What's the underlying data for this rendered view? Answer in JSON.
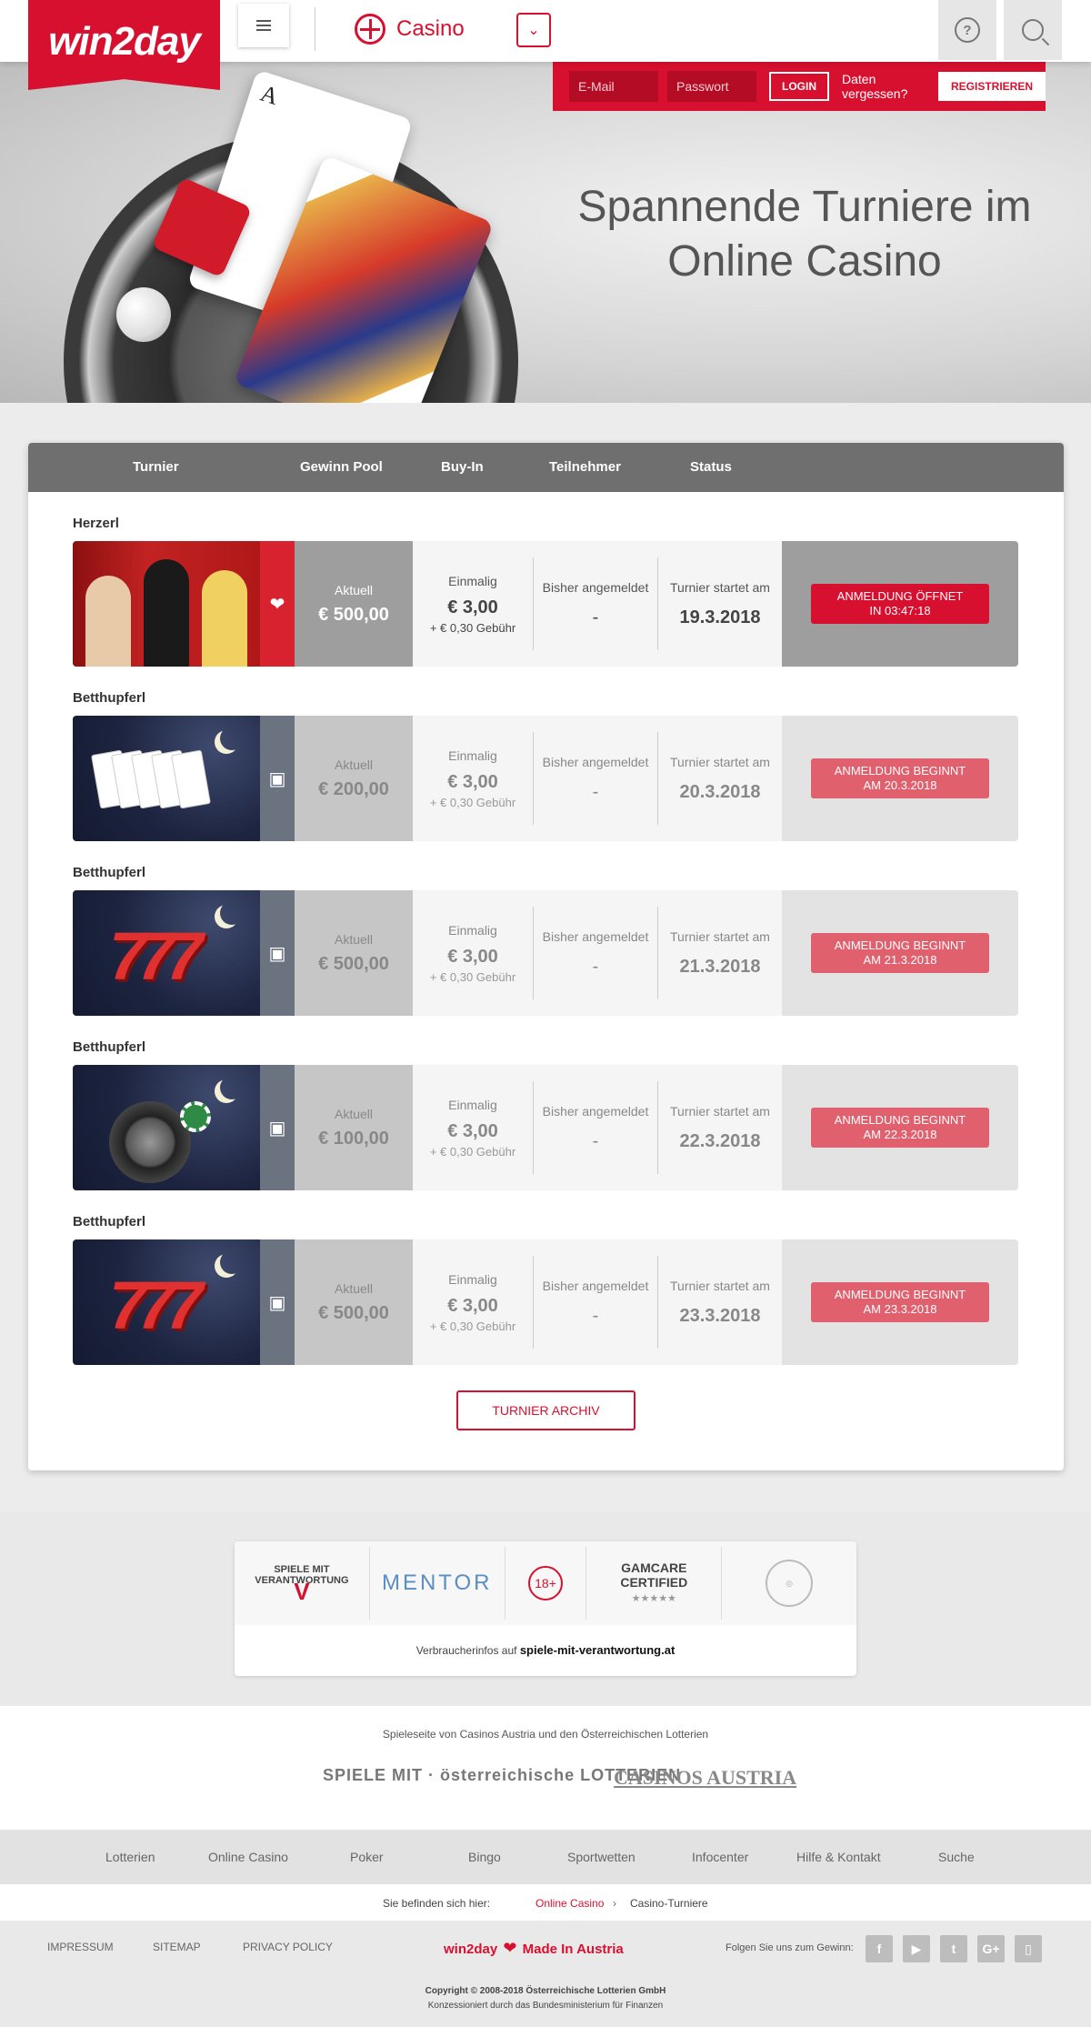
{
  "brand": {
    "logo_text": "win2day",
    "accent": "#d8102f"
  },
  "header": {
    "section_label": "Casino",
    "menu_icon": "hamburger-icon",
    "help_icon": "help-icon",
    "search_icon": "search-icon"
  },
  "login": {
    "email_placeholder": "E-Mail",
    "password_placeholder": "Passwort",
    "login_label": "LOGIN",
    "forgot_label": "Daten vergessen?",
    "register_label": "REGISTRIEREN"
  },
  "hero": {
    "title_line1": "Spannende Turniere im",
    "title_line2": "Online Casino",
    "card_label": "A"
  },
  "table_headers": {
    "turnier": "Turnier",
    "pool": "Gewinn Pool",
    "buyin": "Buy-In",
    "teilnehmer": "Teilnehmer",
    "status": "Status"
  },
  "tournaments": [
    {
      "name": "Herzerl",
      "pool_label": "Aktuell",
      "pool": "€ 500,00",
      "buy_label": "Einmalig",
      "buy": "€ 3,00",
      "fee": "+ € 0,30 Gebühr",
      "reg_label": "Bisher angemeldet",
      "reg": "-",
      "start_label": "Turnier startet am",
      "start": "19.3.2018",
      "status_l1": "ANMELDUNG ÖFFNET",
      "status_l2": "IN 03:47:18",
      "icon": "hearts-icon"
    },
    {
      "name": "Betthupferl",
      "pool_label": "Aktuell",
      "pool": "€ 200,00",
      "buy_label": "Einmalig",
      "buy": "€ 3,00",
      "fee": "+ € 0,30 Gebühr",
      "reg_label": "Bisher angemeldet",
      "reg": "-",
      "start_label": "Turnier startet am",
      "start": "20.3.2018",
      "status_l1": "ANMELDUNG BEGINNT",
      "status_l2": "AM 20.3.2018",
      "icon": "bed-icon"
    },
    {
      "name": "Betthupferl",
      "pool_label": "Aktuell",
      "pool": "€ 500,00",
      "buy_label": "Einmalig",
      "buy": "€ 3,00",
      "fee": "+ € 0,30 Gebühr",
      "reg_label": "Bisher angemeldet",
      "reg": "-",
      "start_label": "Turnier startet am",
      "start": "21.3.2018",
      "status_l1": "ANMELDUNG BEGINNT",
      "status_l2": "AM 21.3.2018",
      "icon": "bed-icon"
    },
    {
      "name": "Betthupferl",
      "pool_label": "Aktuell",
      "pool": "€ 100,00",
      "buy_label": "Einmalig",
      "buy": "€ 3,00",
      "fee": "+ € 0,30 Gebühr",
      "reg_label": "Bisher angemeldet",
      "reg": "-",
      "start_label": "Turnier startet am",
      "start": "22.3.2018",
      "status_l1": "ANMELDUNG BEGINNT",
      "status_l2": "AM 22.3.2018",
      "icon": "bed-icon"
    },
    {
      "name": "Betthupferl",
      "pool_label": "Aktuell",
      "pool": "€ 500,00",
      "buy_label": "Einmalig",
      "buy": "€ 3,00",
      "fee": "+ € 0,30 Gebühr",
      "reg_label": "Bisher angemeldet",
      "reg": "-",
      "start_label": "Turnier startet am",
      "start": "23.3.2018",
      "status_l1": "ANMELDUNG BEGINNT",
      "status_l2": "AM 23.3.2018",
      "icon": "bed-icon"
    }
  ],
  "archive_label": "TURNIER ARCHIV",
  "responsible": {
    "svm_line1": "SPIELE MIT",
    "svm_line2": "VERANTWORTUNG",
    "mentor": "MENTOR",
    "age": "18+",
    "gamcare_l1": "GAMCARE",
    "gamcare_l2": "CERTIFIED",
    "info_prefix": "Verbraucherinfos auf",
    "info_link": "spiele-mit-verantwortung.at"
  },
  "operator": {
    "text": "Spieleseite von Casinos Austria und den Österreichischen Lotterien",
    "logo_left": "SPIELE MIT · österreichische LOTTERIEN",
    "logo_right": "CASINOS AUSTRIA"
  },
  "footer_nav": [
    "Lotterien",
    "Online Casino",
    "Poker",
    "Bingo",
    "Sportwetten",
    "Infocenter",
    "Hilfe & Kontakt",
    "Suche"
  ],
  "breadcrumb": {
    "prefix": "Sie befinden sich hier:",
    "link": "Online Casino",
    "current": "Casino-Turniere"
  },
  "footer": {
    "impressum": "IMPRESSUM",
    "sitemap": "SITEMAP",
    "privacy": "PRIVACY POLICY",
    "made_brand": "win2day",
    "made_text": "Made In Austria",
    "follow": "Folgen Sie uns zum Gewinn:",
    "social": [
      "f",
      "▶",
      "t",
      "G+",
      "▯"
    ],
    "copyright": "Copyright © 2008-2018 Österreichische Lotterien GmbH",
    "license": "Konzessioniert durch das Bundesministerium für Finanzen"
  }
}
